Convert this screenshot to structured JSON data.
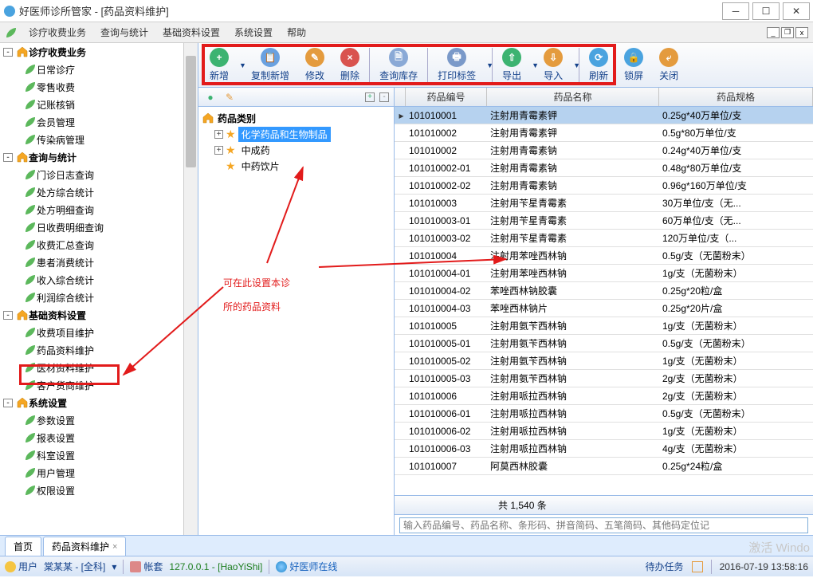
{
  "window": {
    "title": "好医师诊所管家 - [药品资料维护]"
  },
  "menus": [
    "诊疗收费业务",
    "查询与统计",
    "基础资料设置",
    "系统设置",
    "帮助"
  ],
  "nav": [
    {
      "type": "group",
      "label": "诊疗收费业务",
      "children": [
        "日常诊疗",
        "零售收费",
        "记账核销",
        "会员管理",
        "传染病管理"
      ]
    },
    {
      "type": "group",
      "label": "查询与统计",
      "children": [
        "门诊日志查询",
        "处方综合统计",
        "处方明细查询",
        "日收费明细查询",
        "收费汇总查询",
        "患者消费统计",
        "收入综合统计",
        "利润综合统计"
      ]
    },
    {
      "type": "group",
      "label": "基础资料设置",
      "children": [
        "收费项目维护",
        "药品资料维护",
        "医材资料维护",
        "客户货商维护"
      ]
    },
    {
      "type": "group",
      "label": "系统设置",
      "children": [
        "参数设置",
        "报表设置",
        "科室设置",
        "用户管理",
        "权限设置"
      ]
    }
  ],
  "toolbar": [
    {
      "id": "add",
      "label": "新增",
      "color": "#3cb371",
      "sym": "+",
      "dd": true
    },
    {
      "id": "copyadd",
      "label": "复制新增",
      "color": "#6aa1e0",
      "sym": "📋"
    },
    {
      "id": "edit",
      "label": "修改",
      "color": "#e49b3e",
      "sym": "✎"
    },
    {
      "id": "del",
      "label": "删除",
      "color": "#d9534f",
      "sym": "×"
    },
    {
      "id": "stock",
      "label": "查询库存",
      "color": "#8aa9d6",
      "sym": "🗎"
    },
    {
      "id": "print",
      "label": "打印标签",
      "color": "#7a99c9",
      "sym": "🖶",
      "dd": true
    },
    {
      "id": "export",
      "label": "导出",
      "color": "#3cb371",
      "sym": "⇧",
      "dd": true
    },
    {
      "id": "import",
      "label": "导入",
      "color": "#e49b3e",
      "sym": "⇩",
      "dd": true
    },
    {
      "id": "refresh",
      "label": "刷新",
      "color": "#4aa3df",
      "sym": "⟳"
    },
    {
      "id": "lock",
      "label": "锁屏",
      "color": "#4aa3df",
      "sym": "🔒"
    },
    {
      "id": "close",
      "label": "关闭",
      "color": "#e49b3e",
      "sym": "⤶"
    }
  ],
  "tree": {
    "title": "药品类别",
    "items": [
      {
        "label": "化学药品和生物制品",
        "selected": true,
        "expandable": true
      },
      {
        "label": "中成药",
        "expandable": true
      },
      {
        "label": "中药饮片"
      }
    ]
  },
  "gridHead": {
    "code": "药品编号",
    "name": "药品名称",
    "spec": "药品规格"
  },
  "gridRows": [
    {
      "code": "101010001",
      "name": "注射用青霉素钾",
      "spec": "0.25g*40万单位/支",
      "sel": true
    },
    {
      "code": "101010002",
      "name": "注射用青霉素钾",
      "spec": "0.5g*80万单位/支"
    },
    {
      "code": "101010002",
      "name": "注射用青霉素钠",
      "spec": "0.24g*40万单位/支"
    },
    {
      "code": "101010002-01",
      "name": "注射用青霉素钠",
      "spec": "0.48g*80万单位/支"
    },
    {
      "code": "101010002-02",
      "name": "注射用青霉素钠",
      "spec": "0.96g*160万单位/支"
    },
    {
      "code": "101010003",
      "name": "注射用苄星青霉素",
      "spec": "30万单位/支（无..."
    },
    {
      "code": "101010003-01",
      "name": "注射用苄星青霉素",
      "spec": "60万单位/支（无..."
    },
    {
      "code": "101010003-02",
      "name": "注射用苄星青霉素",
      "spec": "120万单位/支（..."
    },
    {
      "code": "101010004",
      "name": "注射用苯唑西林钠",
      "spec": "0.5g/支（无菌粉末）"
    },
    {
      "code": "101010004-01",
      "name": "注射用苯唑西林钠",
      "spec": "1g/支（无菌粉末）"
    },
    {
      "code": "101010004-02",
      "name": "苯唑西林钠胶囊",
      "spec": "0.25g*20粒/盒"
    },
    {
      "code": "101010004-03",
      "name": "苯唑西林钠片",
      "spec": "0.25g*20片/盒"
    },
    {
      "code": "101010005",
      "name": "注射用氨苄西林钠",
      "spec": "1g/支（无菌粉末）"
    },
    {
      "code": "101010005-01",
      "name": "注射用氨苄西林钠",
      "spec": "0.5g/支（无菌粉末）"
    },
    {
      "code": "101010005-02",
      "name": "注射用氨苄西林钠",
      "spec": "1g/支（无菌粉末）"
    },
    {
      "code": "101010005-03",
      "name": "注射用氨苄西林钠",
      "spec": "2g/支（无菌粉末）"
    },
    {
      "code": "101010006",
      "name": "注射用哌拉西林钠",
      "spec": "2g/支（无菌粉末）"
    },
    {
      "code": "101010006-01",
      "name": "注射用哌拉西林钠",
      "spec": "0.5g/支（无菌粉末）"
    },
    {
      "code": "101010006-02",
      "name": "注射用哌拉西林钠",
      "spec": "1g/支（无菌粉末）"
    },
    {
      "code": "101010006-03",
      "name": "注射用哌拉西林钠",
      "spec": "4g/支（无菌粉末）"
    },
    {
      "code": "101010007",
      "name": "阿莫西林胶囊",
      "spec": "0.25g*24粒/盒"
    }
  ],
  "gridFoot": "共 1,540 条",
  "searchPlaceholder": "输入药品编号、药品名称、条形码、拼音简码、五笔简码、其他码定位记",
  "annotation": {
    "line1": "可在此设置本诊",
    "line2": "所的药品资料"
  },
  "tabs": [
    {
      "label": "首页"
    },
    {
      "label": "药品资料维护",
      "closable": true
    }
  ],
  "status": {
    "user_label": "用户",
    "user_name": "棠某某 - [全科]",
    "book_label": "帐套",
    "book_val": "127.0.0.1 - [HaoYiShi]",
    "online": "好医师在线",
    "todo": "待办任务",
    "datetime": "2016-07-19 13:58:16"
  },
  "watermark": "激活 Windo"
}
